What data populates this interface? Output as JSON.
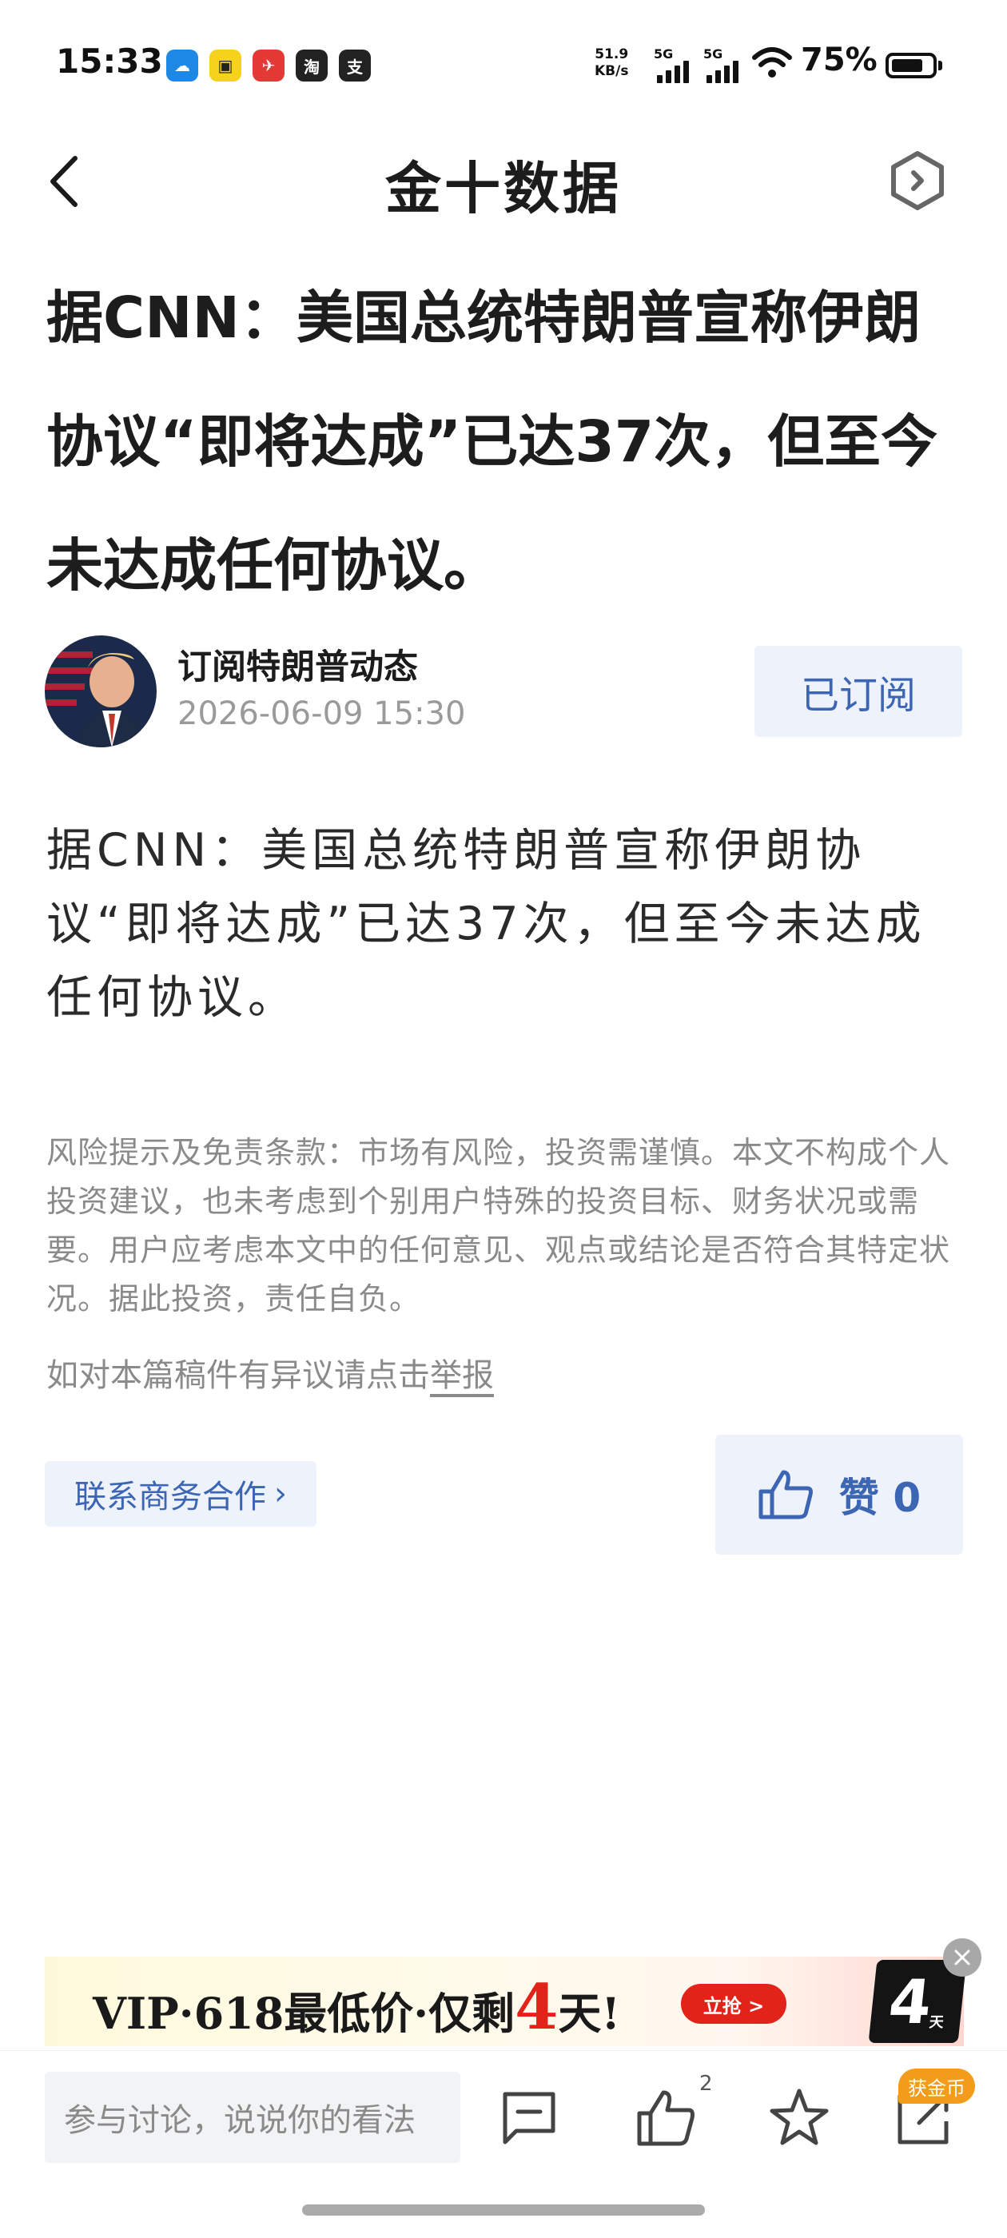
{
  "status_bar": {
    "time": "15:33",
    "app_icons": [
      {
        "name": "weather-app-icon",
        "color": "#1e88e5",
        "glyph": "☁"
      },
      {
        "name": "youku-app-icon",
        "color": "#f7d21b",
        "glyph": "▣"
      },
      {
        "name": "feishu-app-icon",
        "color": "#e53935",
        "glyph": "✈"
      },
      {
        "name": "taobao-app-icon",
        "color": "#222222",
        "glyph": "淘"
      },
      {
        "name": "alipay-app-icon",
        "color": "#222222",
        "glyph": "支"
      }
    ],
    "net_speed_value": "51.9",
    "net_speed_unit": "KB/s",
    "signal_1": "5G",
    "signal_2": "5G",
    "battery": "75%",
    "battery_level": 0.75
  },
  "header": {
    "title": "金十数据"
  },
  "article": {
    "title": "据CNN：美国总统特朗普宣称伊朗协议“即将达成”已达37次，但至今未达成任何协议。",
    "author": "订阅特朗普动态",
    "publish_time": "2026-06-09 15:30",
    "subscribe_label": "已订阅",
    "body": "据CNN：美国总统特朗普宣称伊朗协议“即将达成”已达37次，但至今未达成任何协议。",
    "disclaimer": "风险提示及免责条款：市场有风险，投资需谨慎。本文不构成个人投资建议，也未考虑到个别用户特殊的投资目标、财务状况或需要。用户应考虑本文中的任何意见、观点或结论是否符合其特定状况。据此投资，责任自负。",
    "report_prefix": "如对本篇稿件有异议请点击",
    "report_link": "举报",
    "contact_label": "联系商务合作",
    "like_label": "赞",
    "like_count": "0"
  },
  "banner": {
    "text_prefix": "VIP·618最低价·仅剩",
    "days_number": "4",
    "text_suffix": "天!",
    "cta": "立抢 >",
    "tile_number": "4",
    "tile_unit": "天"
  },
  "bottom_bar": {
    "comment_placeholder": "参与讨论，说说你的看法",
    "like_count": "2",
    "coin_badge": "获金币"
  },
  "colors": {
    "accent_blue": "#3c66b4",
    "soft_blue_bg": "#eef2fb",
    "promo_red": "#e2231a",
    "coin_orange": "#f39b1b"
  }
}
